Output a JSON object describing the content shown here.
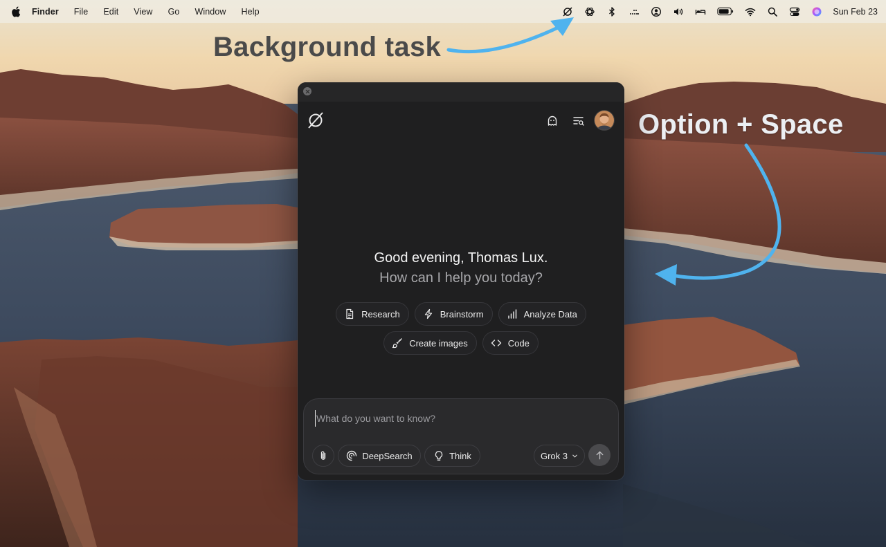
{
  "menubar": {
    "app_name": "Finder",
    "items": [
      "File",
      "Edit",
      "View",
      "Go",
      "Window",
      "Help"
    ],
    "status_icons": [
      "grok-icon",
      "chatgpt-icon",
      "bluetooth-icon",
      "dots-icon",
      "account-icon",
      "volume-icon",
      "bed-icon",
      "battery-icon",
      "wifi-icon",
      "search-icon",
      "control-center-icon",
      "siri-icon"
    ],
    "clock": "Sun Feb 23"
  },
  "annotations": {
    "background_task": "Background task",
    "option_space": "Option + Space",
    "arrow_color": "#4fb3ee"
  },
  "window": {
    "greeting_line1": "Good evening, Thomas Lux.",
    "greeting_line2": "How can I help you today?",
    "chips_row1": [
      {
        "label": "Research",
        "icon": "document-icon"
      },
      {
        "label": "Brainstorm",
        "icon": "lightning-icon"
      },
      {
        "label": "Analyze Data",
        "icon": "bar-chart-icon"
      }
    ],
    "chips_row2": [
      {
        "label": "Create images",
        "icon": "paintbrush-icon"
      },
      {
        "label": "Code",
        "icon": "code-icon"
      }
    ],
    "composer": {
      "placeholder": "What do you want to know?",
      "deepsearch_label": "DeepSearch",
      "think_label": "Think",
      "model": "Grok 3"
    }
  }
}
